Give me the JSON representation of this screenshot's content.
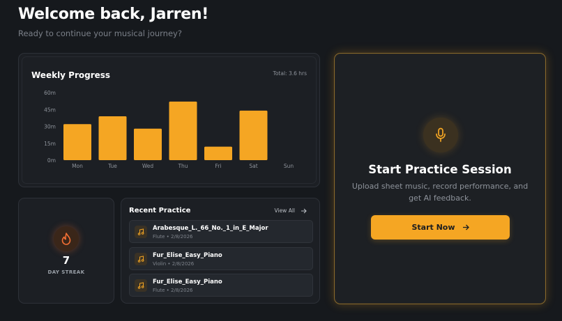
{
  "header": {
    "title": "Welcome back, Jarren!",
    "subtitle": "Ready to continue your musical journey?"
  },
  "weekly": {
    "title": "Weekly Progress",
    "total": "Total: 3.6 hrs"
  },
  "chart_data": {
    "type": "bar",
    "categories": [
      "Mon",
      "Tue",
      "Wed",
      "Thu",
      "Fri",
      "Sat",
      "Sun"
    ],
    "values": [
      32,
      39,
      28,
      52,
      12,
      44,
      0
    ],
    "ylim": [
      0,
      60
    ],
    "yticks": [
      0,
      15,
      30,
      45,
      60
    ],
    "ytick_labels": [
      "0m",
      "15m",
      "30m",
      "45m",
      "60m"
    ],
    "grid": false,
    "bar_color": "#f5a623"
  },
  "streak": {
    "value": "7",
    "label": "DAY STREAK",
    "icon": "flame-icon"
  },
  "recent": {
    "title": "Recent Practice",
    "view_all": "View All",
    "items": [
      {
        "name": "Arabesque_L._66_No._1_in_E_Major",
        "meta": "Flute • 2/8/2026"
      },
      {
        "name": "Fur_Elise_Easy_Piano",
        "meta": "Violin • 2/8/2026"
      },
      {
        "name": "Fur_Elise_Easy_Piano",
        "meta": "Flute • 2/8/2026"
      }
    ]
  },
  "start": {
    "title": "Start Practice Session",
    "description": "Upload sheet music, record performance, and get AI feedback.",
    "button": "Start Now",
    "icon": "microphone-icon"
  },
  "colors": {
    "background": "#16191d",
    "card": "#1c1f24",
    "accent": "#f5a623",
    "flame": "#f26f34"
  }
}
